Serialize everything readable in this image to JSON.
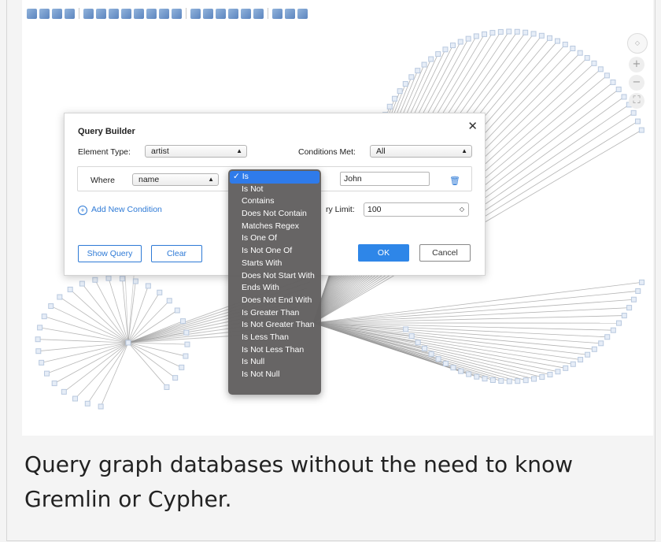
{
  "toolbar": {
    "icons": [
      "file-icon",
      "export-icon",
      "print-icon",
      "page-icon",
      "pointer-icon",
      "hand-icon",
      "move-icon",
      "zoom-in-icon",
      "zoom-out-icon",
      "zoom-actual-icon",
      "zoom-fit-icon",
      "zoom-select-icon",
      "layout-icon",
      "layout-hierarchy-icon",
      "layout-organic-icon",
      "layout-tree-icon",
      "layout-grid-icon",
      "layout-radial-icon",
      "expand-icon",
      "collapse-icon",
      "search-icon"
    ]
  },
  "dialog": {
    "title": "Query Builder",
    "close": "✕",
    "element_type_label": "Element Type:",
    "element_type_value": "artist",
    "conditions_met_label": "Conditions Met:",
    "conditions_met_value": "All",
    "where_label": "Where",
    "property_value": "name",
    "condition_value": "John",
    "add_condition": "Add New Condition",
    "query_limit_label": "ry Limit:",
    "query_limit_value": "100",
    "show_query": "Show Query",
    "clear": "Clear",
    "ok": "OK",
    "cancel": "Cancel"
  },
  "operator_dropdown": {
    "selected": "Is",
    "options": [
      "Is",
      "Is Not",
      "Contains",
      "Does Not Contain",
      "Matches Regex",
      "Is One Of",
      "Is Not One Of",
      "Starts With",
      "Does Not Start With",
      "Ends With",
      "Does Not End With",
      "Is Greater Than",
      "Is Not Greater Than",
      "Is Less Than",
      "Is Not Less Than",
      "Is Null",
      "Is Not Null"
    ]
  },
  "caption": "Query graph databases without the need to know Gremlin or Cypher.",
  "colors": {
    "accent": "#2e86e8",
    "node": "#b9c9df",
    "edge": "#9a9a9a"
  }
}
